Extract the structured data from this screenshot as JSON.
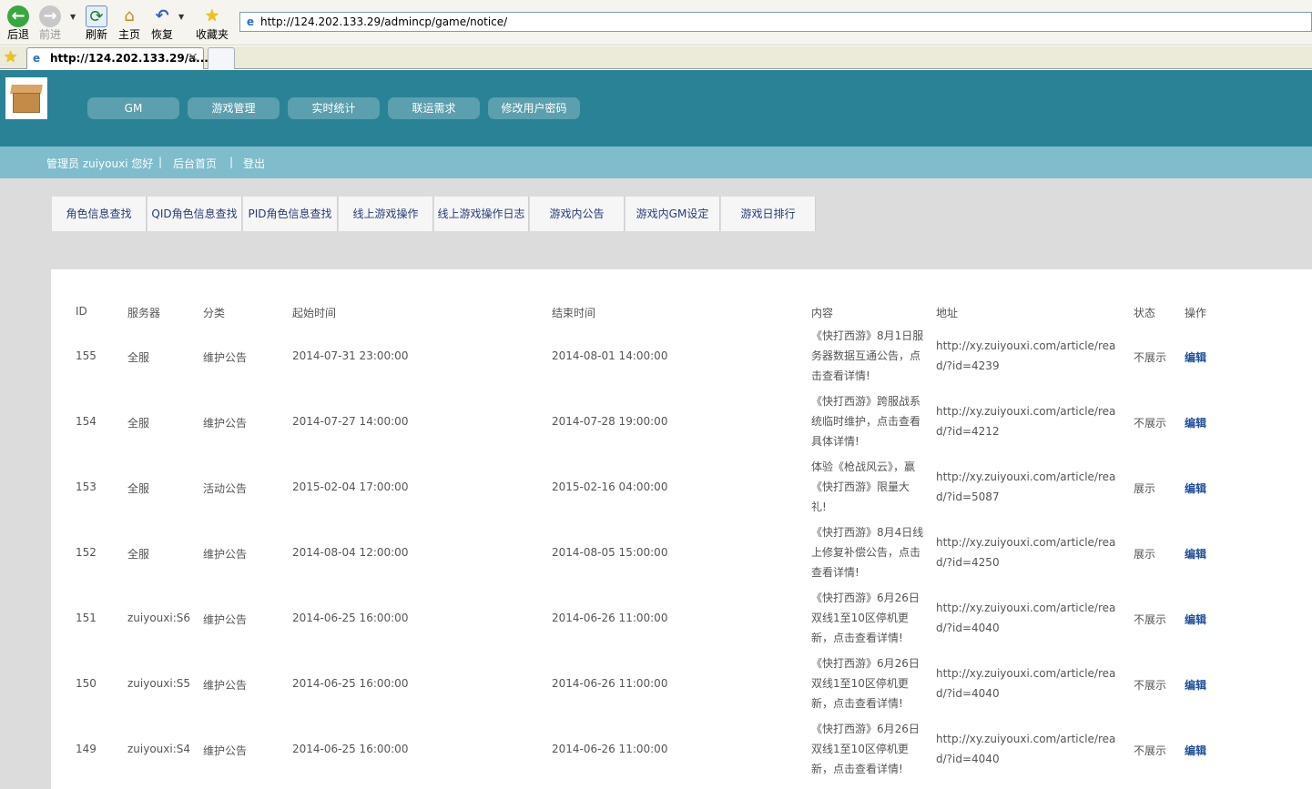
{
  "browser": {
    "toolbar": {
      "back": "后退",
      "forward": "前进",
      "refresh": "刷新",
      "home": "主页",
      "restore": "恢复",
      "favorites": "收藏夹"
    },
    "address": "http://124.202.133.29/admincp/game/notice/",
    "tab_title": "http://124.202.133.29/a...",
    "tab_close": "×"
  },
  "header": {
    "nav": [
      "GM",
      "游戏管理",
      "实时统计",
      "联运需求",
      "修改用户密码"
    ]
  },
  "subbar": {
    "greeting": "管理员 zuiyouxi 您好",
    "sep1": "|",
    "home_link": "后台首页",
    "sep2": "|",
    "logout": "登出"
  },
  "subtabs": [
    "角色信息查找",
    "QID角色信息查找",
    "PID角色信息查找",
    "线上游戏操作",
    "线上游戏操作日志",
    "游戏内公告",
    "游戏内GM设定",
    "游戏日排行"
  ],
  "table": {
    "headers": {
      "id": "ID",
      "server": "服务器",
      "category": "分类",
      "start": "起始时间",
      "end": "结束时间",
      "content": "内容",
      "address": "地址",
      "status": "状态",
      "action": "操作"
    },
    "rows": [
      {
        "id": "155",
        "server": "全服",
        "category": "维护公告",
        "start": "2014-07-31 23:00:00",
        "end": "2014-08-01 14:00:00",
        "content": "《快打西游》8月1日服务器数据互通公告，点击查看详情!",
        "address": "http://xy.zuiyouxi.com/article/read/?id=4239",
        "status": "不展示",
        "action": "编辑"
      },
      {
        "id": "154",
        "server": "全服",
        "category": "维护公告",
        "start": "2014-07-27 14:00:00",
        "end": "2014-07-28 19:00:00",
        "content": "《快打西游》跨服战系统临时维护，点击查看具体详情!",
        "address": "http://xy.zuiyouxi.com/article/read/?id=4212",
        "status": "不展示",
        "action": "编辑"
      },
      {
        "id": "153",
        "server": "全服",
        "category": "活动公告",
        "start": "2015-02-04 17:00:00",
        "end": "2015-02-16 04:00:00",
        "content": "体验《枪战风云》，赢《快打西游》限量大礼!",
        "address": "http://xy.zuiyouxi.com/article/read/?id=5087",
        "status": "展示",
        "action": "编辑"
      },
      {
        "id": "152",
        "server": "全服",
        "category": "维护公告",
        "start": "2014-08-04 12:00:00",
        "end": "2014-08-05 15:00:00",
        "content": "《快打西游》8月4日线上修复补偿公告，点击查看详情!",
        "address": "http://xy.zuiyouxi.com/article/read/?id=4250",
        "status": "展示",
        "action": "编辑"
      },
      {
        "id": "151",
        "server": "zuiyouxi:S6",
        "category": "维护公告",
        "start": "2014-06-25 16:00:00",
        "end": "2014-06-26 11:00:00",
        "content": "《快打西游》6月26日双线1至10区停机更新，点击查看详情!",
        "address": "http://xy.zuiyouxi.com/article/read/?id=4040",
        "status": "不展示",
        "action": "编辑"
      },
      {
        "id": "150",
        "server": "zuiyouxi:S5",
        "category": "维护公告",
        "start": "2014-06-25 16:00:00",
        "end": "2014-06-26 11:00:00",
        "content": "《快打西游》6月26日双线1至10区停机更新，点击查看详情!",
        "address": "http://xy.zuiyouxi.com/article/read/?id=4040",
        "status": "不展示",
        "action": "编辑"
      },
      {
        "id": "149",
        "server": "zuiyouxi:S4",
        "category": "维护公告",
        "start": "2014-06-25 16:00:00",
        "end": "2014-06-26 11:00:00",
        "content": "《快打西游》6月26日双线1至10区停机更新，点击查看详情!",
        "address": "http://xy.zuiyouxi.com/article/read/?id=4040",
        "status": "不展示",
        "action": "编辑"
      }
    ]
  }
}
